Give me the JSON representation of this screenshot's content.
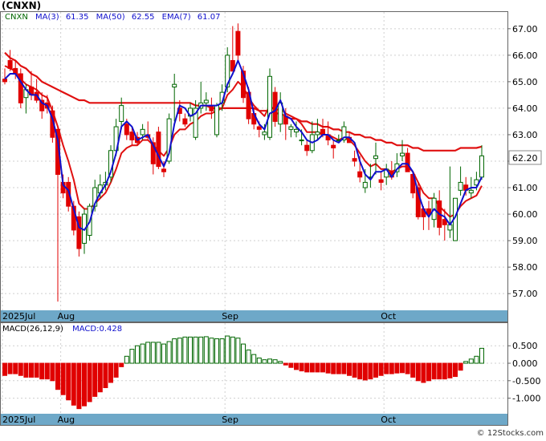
{
  "header": {
    "ticker": "(CNXN)",
    "legend_ticker": "CNXN",
    "ma3": "MA(3)",
    "ma3_value": "61.35",
    "ma50": "MA(50)",
    "ma50_value": "62.55",
    "ema7": "EMA(7)",
    "ema7_value": "61.07"
  },
  "price_panel": {
    "ylim": [
      56.4,
      67.6
    ],
    "ticks": [
      57,
      58,
      59,
      60,
      61,
      62,
      63,
      64,
      65,
      66,
      67
    ],
    "tick_labels": [
      "57.00",
      "58.00",
      "59.00",
      "60.00",
      "61.00",
      "62.00",
      "63.00",
      "64.00",
      "65.00",
      "66.00",
      "67.00"
    ],
    "last_price_label": "62.20",
    "last_price": 62.2,
    "month_labels": [
      "2025Jul",
      "Aug",
      "Sep",
      "Oct"
    ]
  },
  "macd_panel": {
    "title": "MACD(26,12,9)",
    "value_label": "MACD:0.428",
    "ylim": [
      -1.4,
      0.85
    ],
    "ticks": [
      0.5,
      0,
      -0.5,
      -1
    ],
    "tick_labels": [
      "0.500",
      "0.000",
      "-0.500",
      "-1.000"
    ],
    "month_labels": [
      "2025Jul",
      "Aug",
      "Sep",
      "Oct"
    ]
  },
  "colors": {
    "up": "#ffffff",
    "up_border": "#006600",
    "down": "#e00000",
    "ma3": "#1010cc",
    "ma50": "#e01010",
    "ema7": "#e01010",
    "axis_band": "#6ea8c8",
    "grid": "#cfcfcf"
  },
  "footer": {
    "watermark": "© 12Stocks.com"
  },
  "chart_data": {
    "type": "candlestick",
    "title": "(CNXN)",
    "x_month_labels": [
      "2025Jul",
      "Aug",
      "Sep",
      "Oct"
    ],
    "month_start_index": [
      0,
      11,
      42,
      72
    ],
    "candles": [
      [
        65.1,
        65.5,
        64.9,
        65.0
      ],
      [
        65.8,
        66.2,
        65.4,
        65.5
      ],
      [
        65.5,
        65.8,
        65.1,
        65.3
      ],
      [
        65.3,
        65.5,
        64.0,
        64.2
      ],
      [
        64.4,
        64.9,
        63.8,
        64.7
      ],
      [
        64.8,
        65.4,
        64.3,
        64.5
      ],
      [
        64.6,
        65.1,
        64.2,
        64.3
      ],
      [
        64.3,
        64.6,
        63.6,
        63.9
      ],
      [
        64.2,
        64.5,
        63.8,
        64.0
      ],
      [
        63.9,
        64.1,
        62.7,
        62.9
      ],
      [
        63.2,
        63.3,
        56.7,
        61.5
      ],
      [
        61.2,
        61.5,
        60.6,
        60.8
      ],
      [
        61.2,
        61.4,
        60.1,
        60.3
      ],
      [
        60.3,
        60.5,
        59.2,
        59.4
      ],
      [
        59.9,
        60.1,
        58.4,
        58.7
      ],
      [
        58.9,
        60.2,
        58.5,
        60.0
      ],
      [
        59.2,
        60.4,
        59.0,
        60.3
      ],
      [
        60.3,
        61.3,
        60.1,
        61.0
      ],
      [
        60.8,
        61.5,
        60.6,
        61.1
      ],
      [
        61.1,
        61.6,
        60.9,
        61.2
      ],
      [
        61.4,
        62.6,
        61.2,
        62.4
      ],
      [
        62.4,
        63.6,
        62.2,
        63.3
      ],
      [
        63.5,
        64.4,
        63.2,
        64.1
      ],
      [
        63.4,
        63.6,
        62.8,
        63.0
      ],
      [
        63.1,
        63.3,
        62.6,
        62.8
      ],
      [
        62.9,
        63.1,
        62.6,
        62.7
      ],
      [
        63.0,
        63.4,
        62.8,
        63.2
      ],
      [
        63.0,
        63.5,
        62.8,
        62.9
      ],
      [
        62.7,
        62.9,
        61.5,
        61.9
      ],
      [
        63.1,
        63.3,
        61.7,
        61.8
      ],
      [
        61.7,
        62.0,
        61.4,
        61.6
      ],
      [
        62.0,
        63.8,
        61.9,
        63.6
      ],
      [
        64.8,
        65.3,
        63.5,
        64.9
      ],
      [
        64.0,
        64.3,
        63.5,
        63.8
      ],
      [
        63.6,
        63.8,
        63.3,
        63.4
      ],
      [
        63.7,
        64.2,
        63.5,
        64.0
      ],
      [
        62.9,
        64.3,
        62.8,
        64.0
      ],
      [
        64.0,
        65.0,
        63.8,
        64.2
      ],
      [
        64.2,
        64.6,
        63.9,
        64.3
      ],
      [
        64.1,
        64.4,
        63.6,
        63.9
      ],
      [
        63.0,
        64.2,
        62.9,
        64.1
      ],
      [
        64.2,
        64.9,
        63.9,
        64.6
      ],
      [
        64.8,
        66.3,
        64.6,
        66.0
      ],
      [
        65.8,
        67.1,
        65.4,
        65.4
      ],
      [
        66.9,
        67.2,
        65.8,
        66.0
      ],
      [
        65.4,
        65.6,
        64.2,
        64.4
      ],
      [
        64.6,
        64.8,
        63.4,
        63.6
      ],
      [
        63.8,
        64.0,
        63.2,
        63.4
      ],
      [
        63.3,
        63.5,
        62.9,
        63.2
      ],
      [
        63.0,
        63.4,
        62.8,
        63.1
      ],
      [
        62.9,
        65.5,
        62.8,
        65.2
      ],
      [
        64.6,
        64.8,
        63.3,
        63.5
      ],
      [
        63.4,
        64.6,
        63.1,
        64.2
      ],
      [
        63.7,
        64.0,
        62.8,
        63.4
      ],
      [
        63.2,
        63.4,
        62.9,
        63.3
      ],
      [
        63.1,
        63.5,
        62.9,
        63.2
      ],
      [
        62.8,
        63.2,
        62.6,
        62.8
      ],
      [
        62.6,
        62.8,
        62.2,
        62.4
      ],
      [
        62.4,
        63.5,
        62.3,
        63.0
      ],
      [
        63.0,
        63.6,
        62.8,
        63.1
      ],
      [
        63.2,
        63.6,
        62.9,
        63.0
      ],
      [
        63.0,
        63.5,
        62.6,
        62.8
      ],
      [
        62.6,
        62.8,
        62.1,
        62.5
      ],
      [
        62.8,
        63.0,
        62.7,
        62.8
      ],
      [
        62.8,
        63.5,
        62.7,
        63.3
      ],
      [
        62.9,
        63.1,
        62.7,
        62.7
      ],
      [
        62.1,
        62.4,
        61.8,
        62.0
      ],
      [
        61.6,
        62.2,
        61.2,
        61.4
      ],
      [
        61.0,
        61.7,
        60.8,
        61.2
      ],
      [
        61.4,
        61.9,
        61.0,
        61.4
      ],
      [
        62.1,
        62.7,
        61.5,
        62.2
      ],
      [
        61.3,
        61.6,
        60.9,
        61.2
      ],
      [
        61.4,
        61.9,
        61.1,
        61.7
      ],
      [
        61.6,
        62.0,
        61.3,
        61.4
      ],
      [
        61.6,
        62.3,
        61.4,
        61.9
      ],
      [
        62.2,
        62.8,
        62.0,
        62.3
      ],
      [
        62.3,
        62.5,
        61.6,
        61.6
      ],
      [
        61.5,
        61.6,
        60.6,
        60.8
      ],
      [
        61.0,
        61.2,
        59.8,
        59.9
      ],
      [
        60.2,
        60.3,
        59.4,
        59.9
      ],
      [
        60.2,
        60.5,
        59.4,
        60.0
      ],
      [
        59.8,
        60.8,
        59.5,
        60.6
      ],
      [
        60.5,
        60.9,
        59.2,
        59.5
      ],
      [
        59.8,
        60.2,
        59.0,
        59.6
      ],
      [
        59.4,
        61.8,
        59.1,
        59.6
      ],
      [
        59.0,
        60.5,
        59.0,
        60.6
      ],
      [
        60.9,
        61.8,
        60.7,
        61.2
      ],
      [
        61.1,
        61.4,
        60.7,
        60.9
      ],
      [
        60.8,
        61.4,
        60.6,
        60.9
      ],
      [
        61.1,
        61.6,
        60.9,
        61.3
      ],
      [
        61.4,
        62.6,
        61.3,
        62.2
      ]
    ],
    "ma3": [
      65.1,
      65.3,
      65.3,
      65.0,
      64.7,
      64.5,
      64.5,
      64.2,
      64.1,
      63.6,
      62.8,
      61.1,
      60.9,
      60.2,
      59.5,
      59.4,
      59.7,
      60.4,
      60.8,
      61.1,
      61.6,
      62.3,
      63.3,
      63.5,
      63.3,
      62.8,
      62.9,
      63.0,
      62.6,
      62.2,
      61.8,
      62.3,
      63.4,
      64.1,
      64.0,
      63.7,
      63.8,
      64.1,
      64.1,
      64.1,
      64.1,
      64.2,
      64.9,
      65.3,
      65.8,
      65.3,
      64.7,
      63.8,
      63.4,
      63.2,
      63.8,
      63.9,
      64.3,
      63.7,
      63.6,
      63.3,
      63.1,
      62.8,
      62.7,
      62.8,
      63.0,
      63.0,
      62.8,
      62.7,
      62.9,
      62.9,
      62.7,
      62.0,
      61.5,
      61.3,
      61.6,
      61.6,
      61.7,
      61.4,
      61.7,
      61.9,
      61.9,
      61.6,
      60.8,
      60.2,
      59.9,
      60.2,
      60.0,
      59.9,
      59.6,
      59.9,
      60.4,
      60.9,
      61.0,
      61.0,
      61.4
    ],
    "ma50": [
      66.1,
      65.9,
      65.8,
      65.6,
      65.5,
      65.3,
      65.2,
      65.0,
      64.9,
      64.8,
      64.7,
      64.6,
      64.5,
      64.4,
      64.3,
      64.3,
      64.2,
      64.2,
      64.2,
      64.2,
      64.2,
      64.2,
      64.2,
      64.2,
      64.2,
      64.2,
      64.2,
      64.2,
      64.2,
      64.2,
      64.2,
      64.2,
      64.2,
      64.2,
      64.2,
      64.2,
      64.1,
      64.1,
      64.1,
      64.0,
      64.0,
      64.0,
      64.0,
      64.0,
      64.0,
      64.0,
      64.0,
      64.0,
      63.9,
      63.9,
      63.9,
      63.8,
      63.8,
      63.7,
      63.6,
      63.6,
      63.5,
      63.5,
      63.4,
      63.4,
      63.3,
      63.3,
      63.2,
      63.2,
      63.1,
      63.1,
      63.0,
      63.0,
      62.9,
      62.9,
      62.8,
      62.8,
      62.7,
      62.7,
      62.6,
      62.6,
      62.6,
      62.5,
      62.5,
      62.4,
      62.4,
      62.4,
      62.4,
      62.4,
      62.4,
      62.4,
      62.5,
      62.5,
      62.5,
      62.5,
      62.55
    ],
    "ema7": [
      65.6,
      65.5,
      65.4,
      65.1,
      64.9,
      64.8,
      64.7,
      64.5,
      64.4,
      63.9,
      63.3,
      62.6,
      62.0,
      61.3,
      60.4,
      60.2,
      60.2,
      60.4,
      60.6,
      60.8,
      61.2,
      61.7,
      62.3,
      62.5,
      62.6,
      62.6,
      62.8,
      62.8,
      62.6,
      62.4,
      62.2,
      62.5,
      63.0,
      63.2,
      63.2,
      63.4,
      63.5,
      63.7,
      63.8,
      63.8,
      63.9,
      64.0,
      64.5,
      64.7,
      65.0,
      64.8,
      64.4,
      64.1,
      63.9,
      63.7,
      64.1,
      63.9,
      64.0,
      63.8,
      63.7,
      63.6,
      63.4,
      63.1,
      63.1,
      63.1,
      63.0,
      63.0,
      62.9,
      62.8,
      62.9,
      62.8,
      62.6,
      62.3,
      62.0,
      61.8,
      61.9,
      61.7,
      61.7,
      61.6,
      61.7,
      61.8,
      61.8,
      61.6,
      61.2,
      60.8,
      60.6,
      60.6,
      60.3,
      60.1,
      59.9,
      60.0,
      60.3,
      60.5,
      60.6,
      60.7,
      61.07
    ],
    "macd": [
      -0.35,
      -0.3,
      -0.3,
      -0.35,
      -0.4,
      -0.4,
      -0.4,
      -0.45,
      -0.45,
      -0.5,
      -0.75,
      -0.9,
      -1.05,
      -1.2,
      -1.3,
      -1.22,
      -1.1,
      -0.95,
      -0.82,
      -0.7,
      -0.55,
      -0.4,
      -0.1,
      0.2,
      0.4,
      0.5,
      0.55,
      0.6,
      0.6,
      0.6,
      0.55,
      0.62,
      0.7,
      0.72,
      0.75,
      0.75,
      0.75,
      0.75,
      0.76,
      0.72,
      0.7,
      0.7,
      0.78,
      0.75,
      0.72,
      0.55,
      0.38,
      0.25,
      0.15,
      0.1,
      0.12,
      0.1,
      0.05,
      -0.05,
      -0.12,
      -0.18,
      -0.22,
      -0.25,
      -0.25,
      -0.25,
      -0.25,
      -0.28,
      -0.3,
      -0.3,
      -0.3,
      -0.35,
      -0.4,
      -0.45,
      -0.48,
      -0.45,
      -0.4,
      -0.35,
      -0.3,
      -0.3,
      -0.28,
      -0.27,
      -0.3,
      -0.4,
      -0.5,
      -0.55,
      -0.5,
      -0.45,
      -0.45,
      -0.45,
      -0.42,
      -0.38,
      -0.2,
      0.05,
      0.12,
      0.2,
      0.428
    ]
  }
}
